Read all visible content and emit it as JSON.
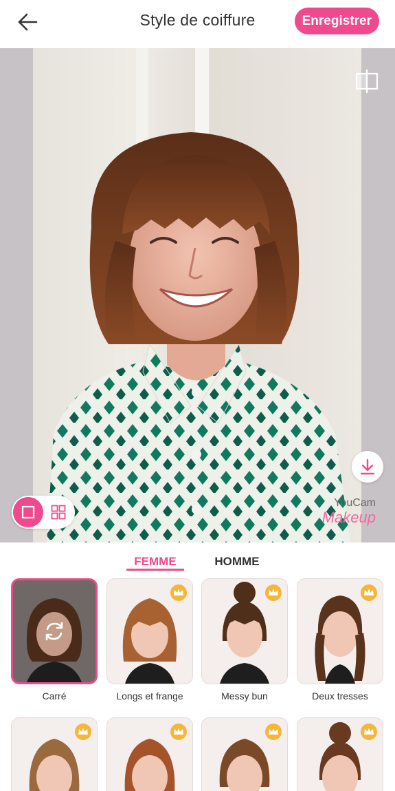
{
  "header": {
    "back_icon": "arrow-left-icon",
    "title": "Style de coiffure",
    "save_label": "Enregistrer"
  },
  "photo": {
    "watermark_line1": "YouCam",
    "watermark_line2": "Makeup"
  },
  "tabs": [
    {
      "label": "FEMME",
      "active": true
    },
    {
      "label": "HOMME",
      "active": false
    }
  ],
  "styles": [
    {
      "label": "Carré",
      "premium": false,
      "selected": true
    },
    {
      "label": "Longs et frange",
      "premium": true,
      "selected": false
    },
    {
      "label": "Messy bun",
      "premium": true,
      "selected": false
    },
    {
      "label": "Deux tresses",
      "premium": true,
      "selected": false
    },
    {
      "label": "",
      "premium": true,
      "selected": false
    },
    {
      "label": "",
      "premium": true,
      "selected": false
    },
    {
      "label": "",
      "premium": true,
      "selected": false
    },
    {
      "label": "",
      "premium": true,
      "selected": false
    }
  ],
  "colors": {
    "accent": "#ee4a8d",
    "crown": "#f4b63b",
    "shirt_green": "#0f7a5e"
  }
}
